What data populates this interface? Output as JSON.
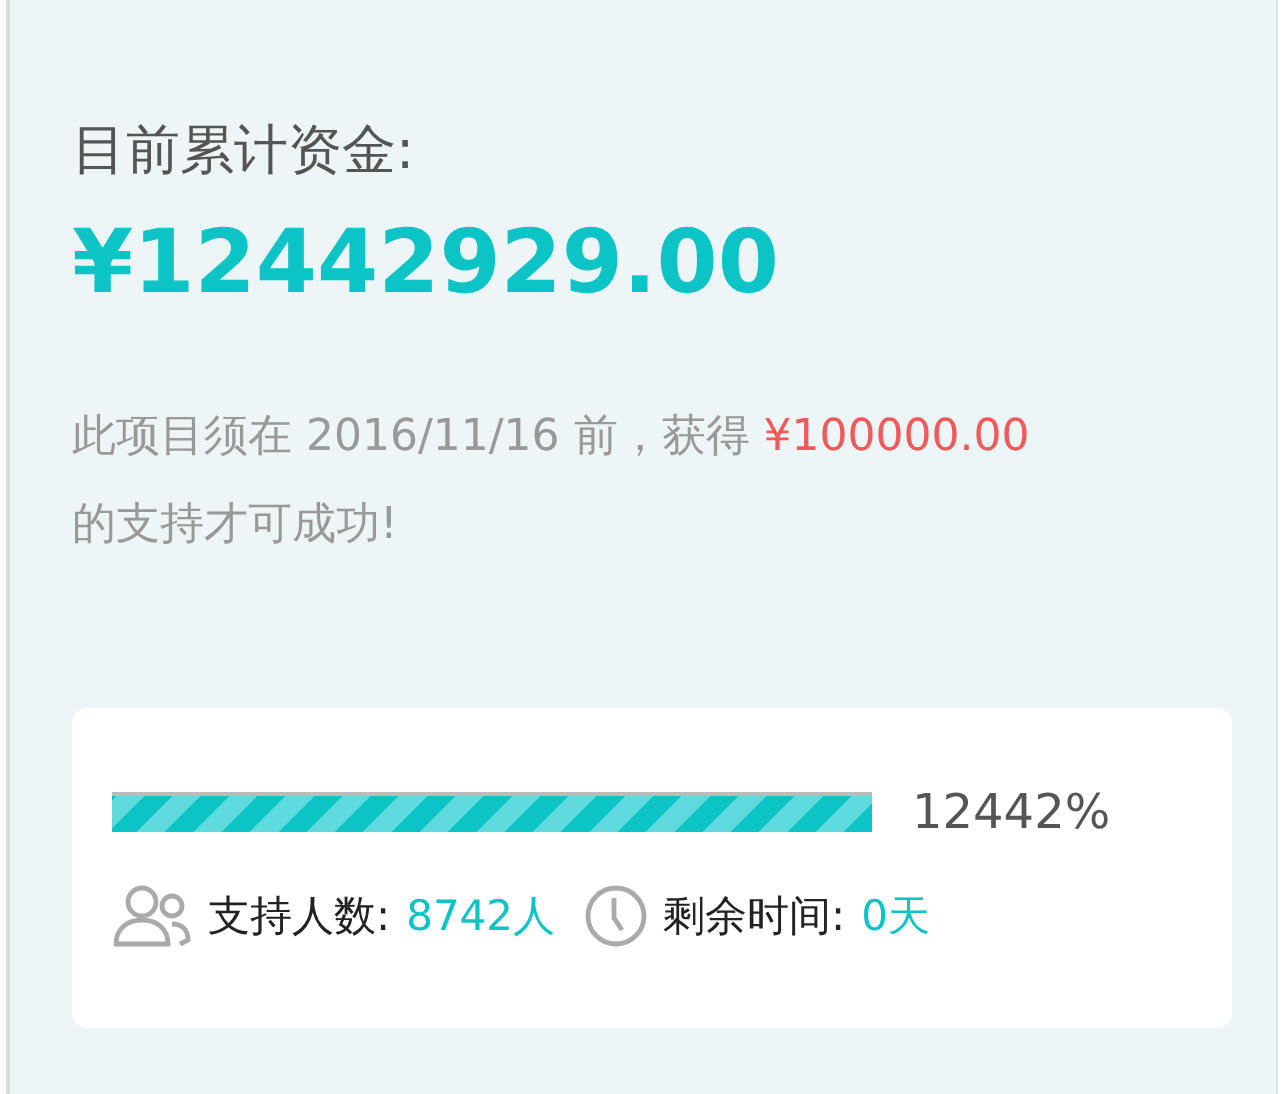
{
  "funding": {
    "label": "目前累计资金:",
    "amount": "¥12442929.00"
  },
  "notice": {
    "before": "此项目须在 2016/11/16 前，获得 ",
    "goal": "¥100000.00",
    "after": "的支持才可成功!"
  },
  "progress": {
    "level": 1,
    "percent": "12442%"
  },
  "stats": [
    {
      "kind": "backers",
      "label": "支持人数:",
      "value": "8742人"
    },
    {
      "kind": "time",
      "label": "剩余时间:",
      "value": "0天"
    }
  ]
}
